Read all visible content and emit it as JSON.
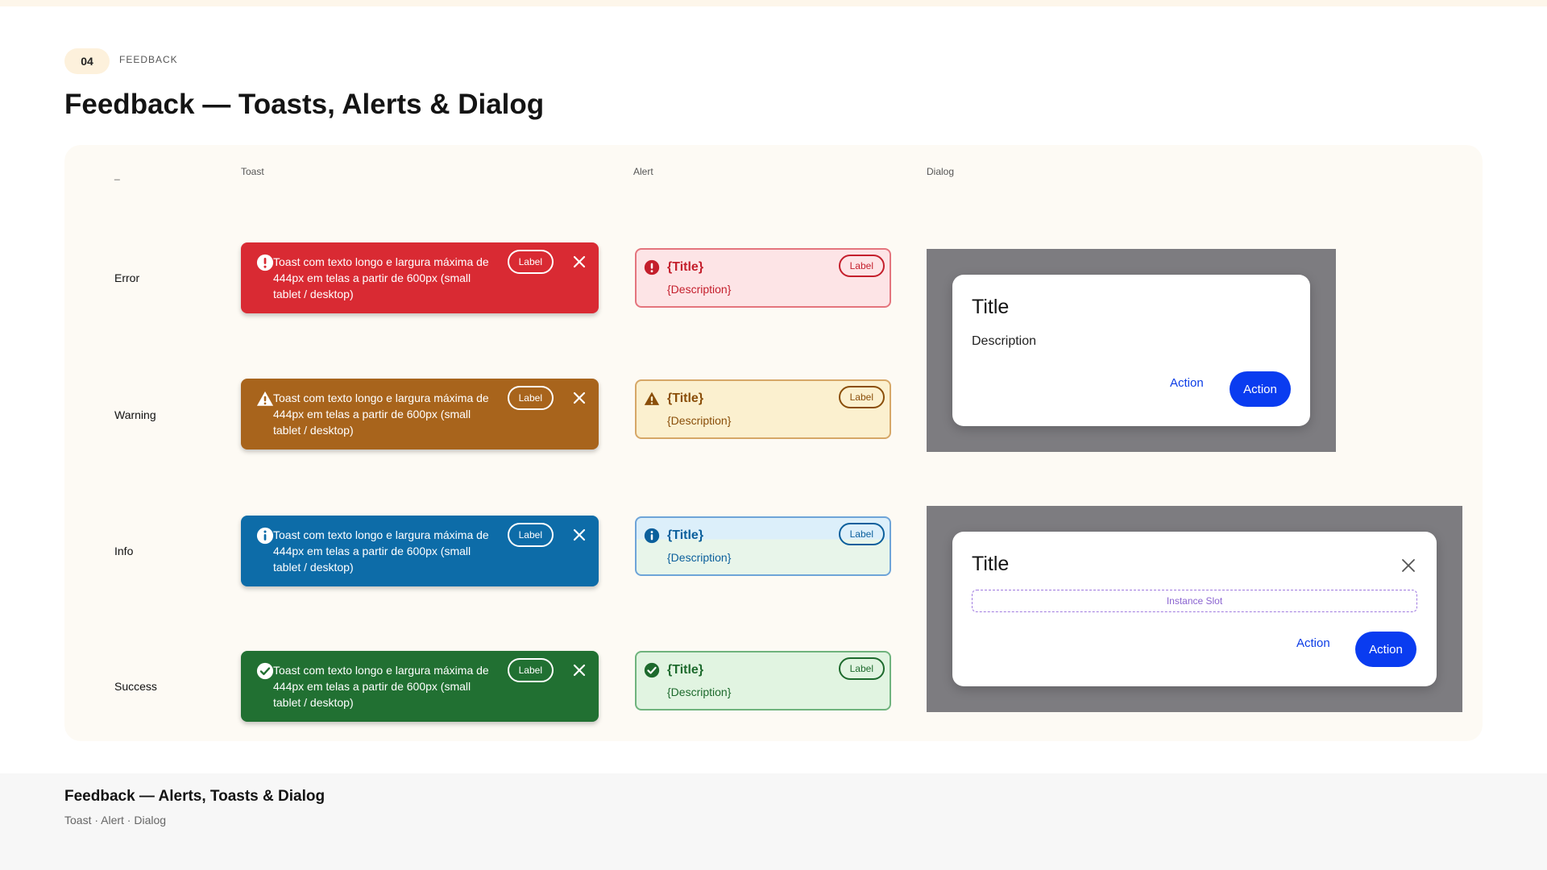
{
  "section": {
    "number": "04",
    "label": "FEEDBACK"
  },
  "page_title": "Feedback — Toasts, Alerts & Dialog",
  "columns": {
    "state": "_",
    "toast": "Toast",
    "alert": "Alert",
    "dialog": "Dialog"
  },
  "rows": {
    "error": "Error",
    "warning": "Warning",
    "info": "Info",
    "success": "Success"
  },
  "toast": {
    "text": "Toast com texto longo e largura máxima de 444px em telas a partir de 600px (small tablet / desktop)",
    "label": "Label",
    "icons": {
      "error": "error-circle-icon",
      "warning": "warning-triangle-icon",
      "info": "info-circle-icon",
      "success": "check-circle-icon",
      "close": "close-icon"
    }
  },
  "alert": {
    "title": "{Title}",
    "description": "{Description}",
    "label": "Label"
  },
  "dialog_simple": {
    "title": "Title",
    "description": "Description",
    "action_text": "Action",
    "action_filled": "Action"
  },
  "dialog_slot": {
    "title": "Title",
    "slot_label": "Instance Slot",
    "action_text": "Action",
    "action_filled": "Action"
  },
  "colors": {
    "error": "#d92a33",
    "warning": "#a8641c",
    "info": "#0d6ca8",
    "success": "#217032",
    "primary_action": "#0a3cf0",
    "scrim": "#7d7c80"
  },
  "footer": {
    "title": "Feedback — Alerts, Toasts & Dialog",
    "subtitle": "Toast · Alert · Dialog"
  }
}
